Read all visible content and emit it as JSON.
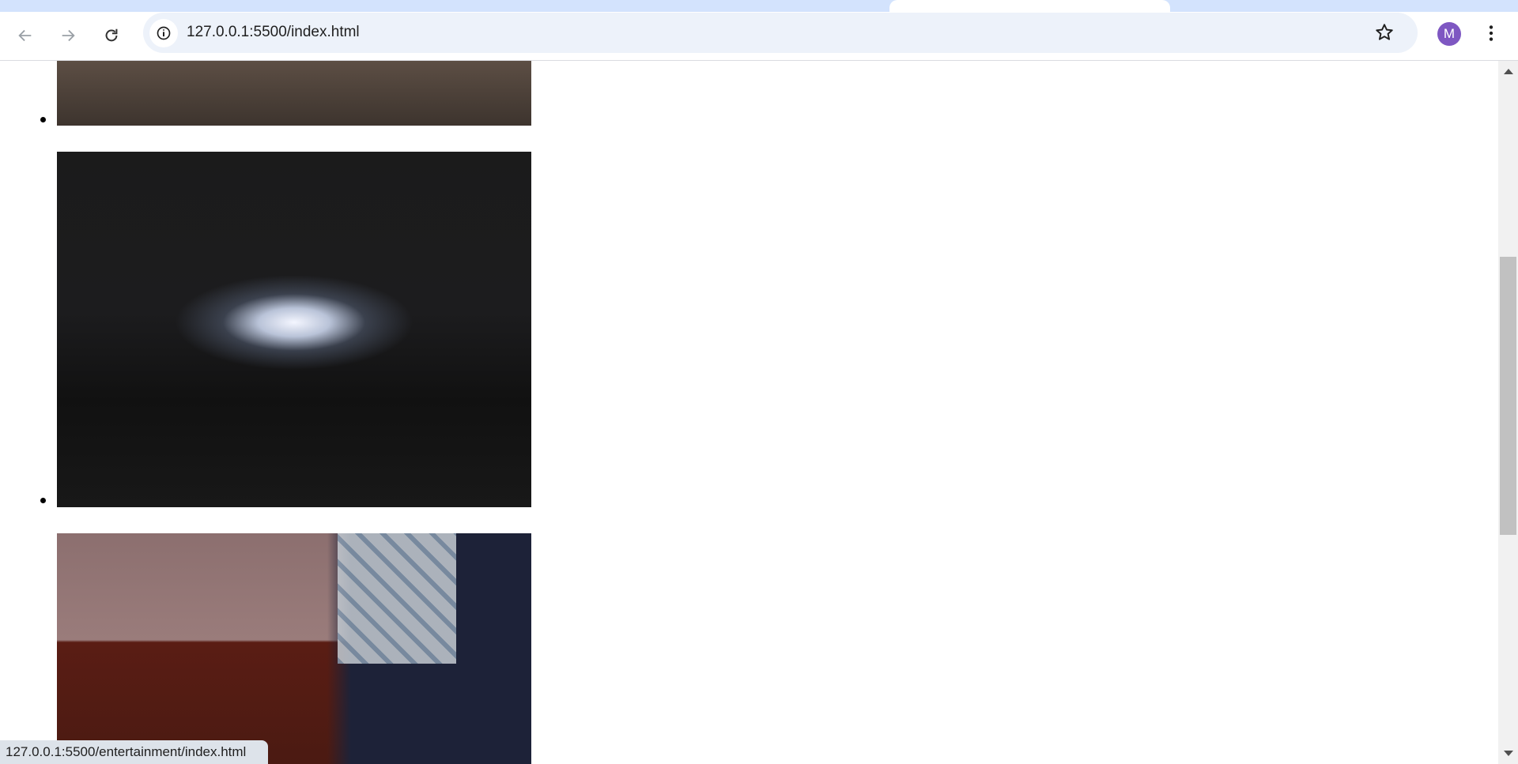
{
  "browser": {
    "url": "127.0.0.1:5500/index.html",
    "profile_initial": "M",
    "profile_color": "#7e57c2",
    "icons": [
      "back-icon",
      "forward-icon",
      "reload-icon",
      "info-icon",
      "star-icon",
      "more-menu-icon"
    ]
  },
  "page": {
    "list_items": [
      {
        "image": "sneakers-on-pavement"
      },
      {
        "image": "concert-crowd-stage-lights"
      },
      {
        "image": "man-reading-book"
      }
    ]
  },
  "status_bar": {
    "link_url": "127.0.0.1:5500/entertainment/index.html"
  }
}
